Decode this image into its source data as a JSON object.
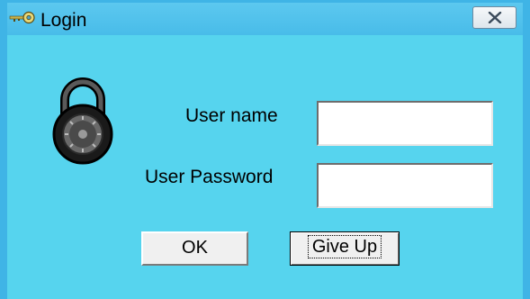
{
  "window": {
    "title": "Login",
    "title_icon": "key-icon",
    "close_icon": "close-icon"
  },
  "form": {
    "lock_icon": "padlock-icon",
    "username_label": "User name",
    "username_value": "",
    "password_label": "User Password",
    "password_value": ""
  },
  "buttons": {
    "ok_label": "OK",
    "give_up_label": "Give Up"
  },
  "colors": {
    "window_bg": "#56d4ee",
    "border": "#3fb4e6"
  }
}
